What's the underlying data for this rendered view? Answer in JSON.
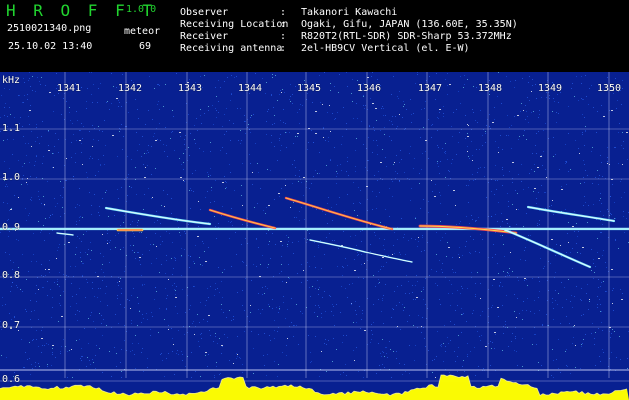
{
  "app": {
    "name": "H R O F F T",
    "version": "1.0.0"
  },
  "observation": {
    "file_name": "2510021340.png",
    "timestamp": "25.10.02 13:40",
    "event_label": "meteor",
    "event_count": "69"
  },
  "station": {
    "fields": [
      {
        "label": "Observer",
        "value": "Takanori Kawachi"
      },
      {
        "label": "Receiving Location",
        "value": "Ogaki, Gifu, JAPAN (136.60E, 35.35N)"
      },
      {
        "label": "Receiver",
        "value": "R820T2(RTL-SDR) SDR-Sharp 53.372MHz"
      },
      {
        "label": "Receiving antenna",
        "value": "2el-HB9CV Vertical (el. E-W)"
      }
    ],
    "separator": ":"
  },
  "chart_data": {
    "type": "heatmap",
    "ylabel": "kHz",
    "x_ticks": [
      "1341",
      "1342",
      "1343",
      "1344",
      "1345",
      "1346",
      "1347",
      "1348",
      "1349",
      "1350"
    ],
    "y_ticks": [
      "1.1",
      "1.0",
      "0.9",
      "0.8",
      "0.7",
      "0.6"
    ],
    "x_range": [
      "1340.5",
      "1350.5"
    ],
    "y_range": [
      0.58,
      1.14
    ],
    "grid": "on",
    "colors": {
      "background": "#082091",
      "noise": "#2f6bff",
      "signal": "#ffffff",
      "meteor_hot": "#ff4d4d",
      "meteor_warm": "#ffe14a",
      "meteor_cool": "#7ff0ff",
      "spectrum": "#ffff00"
    }
  }
}
